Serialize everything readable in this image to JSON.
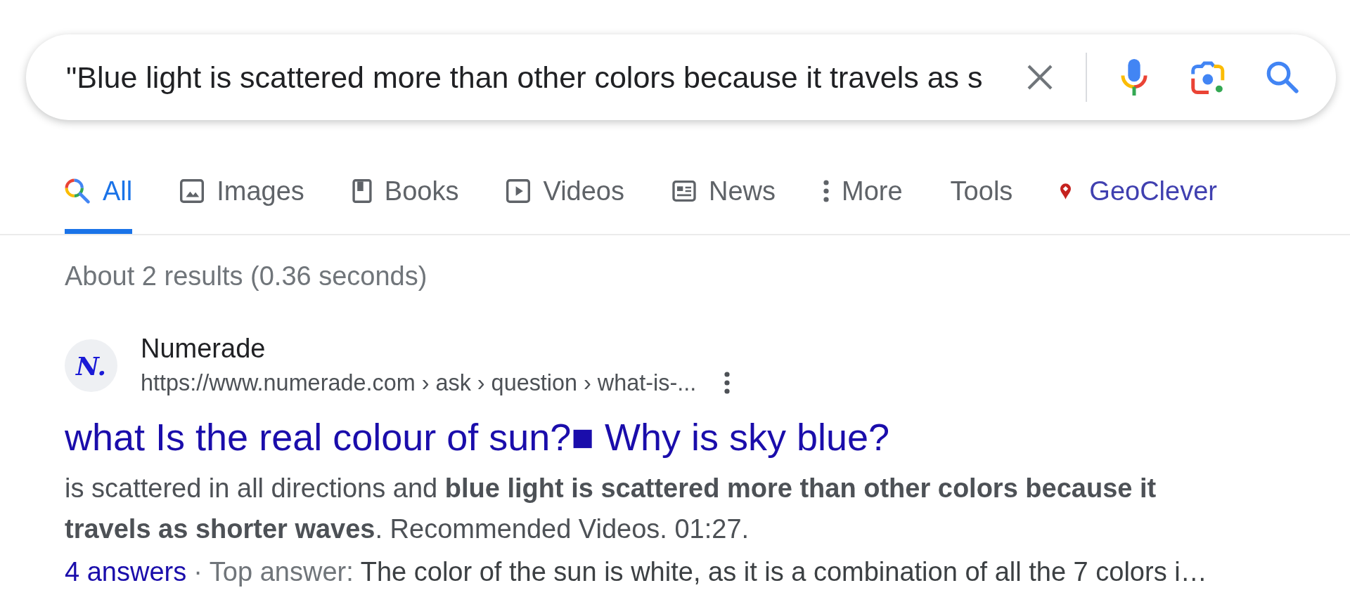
{
  "search": {
    "value": "\"Blue light is scattered more than other colors because it travels as s"
  },
  "tabs": [
    {
      "label": "All",
      "kind": "all",
      "selected": true
    },
    {
      "label": "Images",
      "kind": "images",
      "selected": false
    },
    {
      "label": "Books",
      "kind": "books",
      "selected": false
    },
    {
      "label": "Videos",
      "kind": "videos",
      "selected": false
    },
    {
      "label": "News",
      "kind": "news",
      "selected": false
    },
    {
      "label": "More",
      "kind": "more",
      "selected": false
    },
    {
      "label": "Tools",
      "kind": "tools",
      "selected": false
    },
    {
      "label": "GeoClever",
      "kind": "extension",
      "selected": false
    }
  ],
  "result_stats": "About 2 results (0.36 seconds)",
  "results": [
    {
      "favicon_text": "N.",
      "site_name": "Numerade",
      "url": "https://www.numerade.com › ask › question › what-is-...",
      "title": "what Is the real colour of sun?■ Why is sky blue?",
      "snippet": "is scattered in all directions and **blue light is scattered more than other colors because it travels as shorter waves**. Recommended Videos. 01:27.",
      "answers_link": "4 answers",
      "separator": "·",
      "answer_label": "Top answer:",
      "answer_text": "The color of the sun is white, as it is a combination of all the 7 colors i…"
    }
  ]
}
